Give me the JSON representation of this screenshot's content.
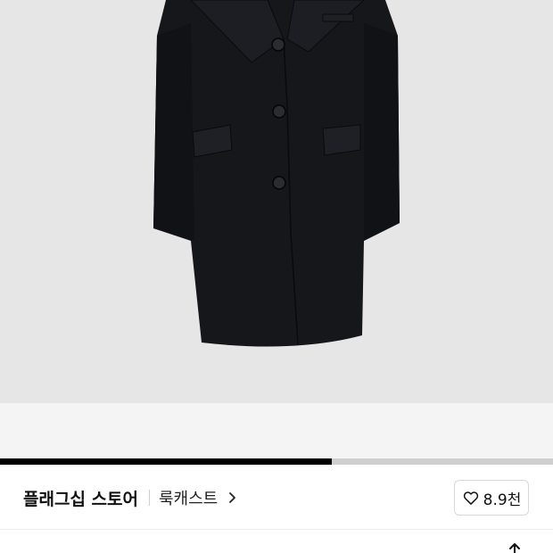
{
  "product_image": {
    "description_icon": "coat-image",
    "background_color": "#e6e6e6",
    "coat_color": "#16171b"
  },
  "gallery_progress": {
    "fraction": 0.6,
    "fill_color": "#000000",
    "track_color": "#cfcfcf"
  },
  "store": {
    "name": "플래그십 스토어",
    "lookcast_label": "룩캐스트",
    "chevron_icon": "chevron-right-icon"
  },
  "like": {
    "icon": "heart-outline-icon",
    "count": "8.9천"
  },
  "next_section": {
    "share_icon": "share-icon"
  }
}
